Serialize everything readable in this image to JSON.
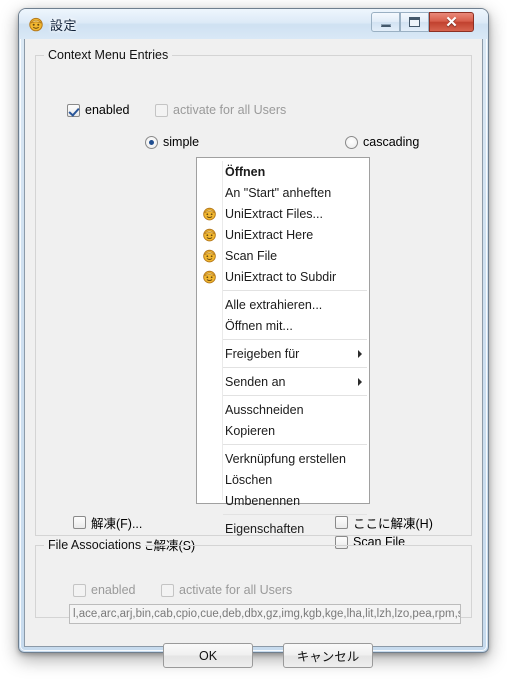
{
  "window": {
    "title": "設定",
    "app_icon": "uniextract-icon",
    "controls": {
      "minimize": "minimize-button",
      "maximize": "maximize-button",
      "close_glyph": "✕"
    }
  },
  "context_group": {
    "title": "Context Menu Entries",
    "enabled": {
      "label": "enabled",
      "checked": true,
      "disabled": false
    },
    "all_users": {
      "label": "activate for all Users",
      "checked": false,
      "disabled": true
    },
    "mode": {
      "simple": {
        "label": "simple",
        "selected": true
      },
      "cascading": {
        "label": "cascading",
        "selected": false
      }
    },
    "options": {
      "extract_f": {
        "label": "解凍(F)...",
        "checked": false
      },
      "extract_folder": {
        "label": "フォルダに解凍(S)",
        "checked": true
      },
      "extract_here": {
        "label": "ここに解凍(H)",
        "checked": false
      },
      "scan_file": {
        "label": "Scan File",
        "checked": false
      }
    }
  },
  "menu_preview": {
    "items": [
      {
        "label": "Öffnen",
        "bold": true,
        "icon": null,
        "submenu": false
      },
      {
        "label": "An \"Start\" anheften",
        "bold": false,
        "icon": null,
        "submenu": false
      },
      {
        "label": "UniExtract Files...",
        "bold": false,
        "icon": "uniextract-icon",
        "submenu": false
      },
      {
        "label": "UniExtract Here",
        "bold": false,
        "icon": "uniextract-icon",
        "submenu": false
      },
      {
        "label": "Scan File",
        "bold": false,
        "icon": "uniextract-icon",
        "submenu": false
      },
      {
        "label": "UniExtract to Subdir",
        "bold": false,
        "icon": "uniextract-icon",
        "submenu": false
      },
      {
        "separator": true
      },
      {
        "label": "Alle extrahieren...",
        "bold": false,
        "icon": null,
        "submenu": false
      },
      {
        "label": "Öffnen mit...",
        "bold": false,
        "icon": null,
        "submenu": false
      },
      {
        "separator": true
      },
      {
        "label": "Freigeben für",
        "bold": false,
        "icon": null,
        "submenu": true
      },
      {
        "separator": true
      },
      {
        "label": "Senden an",
        "bold": false,
        "icon": null,
        "submenu": true
      },
      {
        "separator": true
      },
      {
        "label": "Ausschneiden",
        "bold": false,
        "icon": null,
        "submenu": false
      },
      {
        "label": "Kopieren",
        "bold": false,
        "icon": null,
        "submenu": false
      },
      {
        "separator": true
      },
      {
        "label": "Verknüpfung erstellen",
        "bold": false,
        "icon": null,
        "submenu": false
      },
      {
        "label": "Löschen",
        "bold": false,
        "icon": null,
        "submenu": false
      },
      {
        "label": "Umbenennen",
        "bold": false,
        "icon": null,
        "submenu": false
      },
      {
        "separator": true
      },
      {
        "label": "Eigenschaften",
        "bold": false,
        "icon": null,
        "submenu": false
      }
    ]
  },
  "assoc_group": {
    "title": "File Associations",
    "enabled": {
      "label": "enabled",
      "checked": false,
      "disabled": true
    },
    "all_users": {
      "label": "activate for all Users",
      "checked": false,
      "disabled": true
    },
    "extensions_value": "l,ace,arc,arj,bin,cab,cpio,cue,deb,dbx,gz,img,kgb,kge,lha,lit,lzh,lzo,pea,rpm,sit,uha,z"
  },
  "buttons": {
    "ok": "OK",
    "cancel": "キャンセル"
  },
  "colors": {
    "dialog_bg": "#f0f0f0",
    "title_bar": "#dce9f5",
    "close_button": "#c1412f",
    "accent_checkmark": "#2a5699",
    "radio_dot": "#1f4d8f",
    "menu_bg": "#ffffff",
    "icon_yellow": "#f5c33b"
  }
}
